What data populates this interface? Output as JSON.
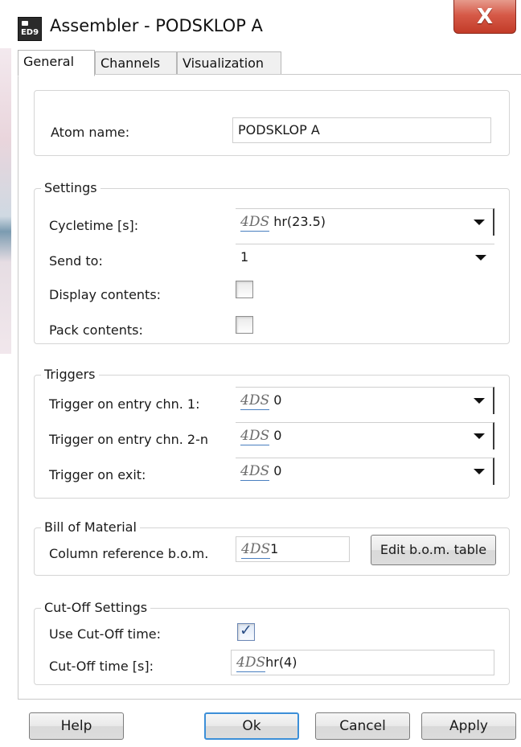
{
  "window": {
    "icon_text": "ED9",
    "title": "Assembler - PODSKLOP A",
    "close_glyph": "X"
  },
  "tabs": [
    {
      "label": "General",
      "active": true
    },
    {
      "label": "Channels",
      "active": false
    },
    {
      "label": "Visualization",
      "active": false
    }
  ],
  "atom": {
    "label": "Atom name:",
    "value": "PODSKLOP A"
  },
  "settings": {
    "title": "Settings",
    "cycletime": {
      "label": "Cycletime [s]:",
      "prefix": "4DS",
      "value": "hr(23.5)"
    },
    "send_to": {
      "label": "Send to:",
      "value": "1"
    },
    "display_contents": {
      "label": "Display contents:",
      "checked": false
    },
    "pack_contents": {
      "label": "Pack contents:",
      "checked": false
    }
  },
  "triggers": {
    "title": "Triggers",
    "entry_1": {
      "label": "Trigger on entry chn. 1:",
      "prefix": "4DS",
      "value": "0"
    },
    "entry_2n": {
      "label": "Trigger on entry chn. 2-n",
      "prefix": "4DS",
      "value": "0"
    },
    "exit": {
      "label": "Trigger on exit:",
      "prefix": "4DS",
      "value": "0"
    }
  },
  "bom": {
    "title": "Bill of Material",
    "column_ref": {
      "label": "Column reference b.o.m.",
      "prefix": "4DS",
      "value": "1"
    },
    "edit_button": "Edit b.o.m. table"
  },
  "cutoff": {
    "title": "Cut-Off Settings",
    "use": {
      "label": "Use Cut-Off time:",
      "checked": true,
      "check_glyph": "✓"
    },
    "time": {
      "label": "Cut-Off time [s]:",
      "prefix": "4DS",
      "value": "hr(4)"
    }
  },
  "buttons": {
    "help": "Help",
    "ok": "Ok",
    "cancel": "Cancel",
    "apply": "Apply"
  },
  "colors": {
    "close_button": "#d65a48",
    "default_button_border": "#3c8fd8",
    "fds_underline": "#4a7fc0"
  }
}
